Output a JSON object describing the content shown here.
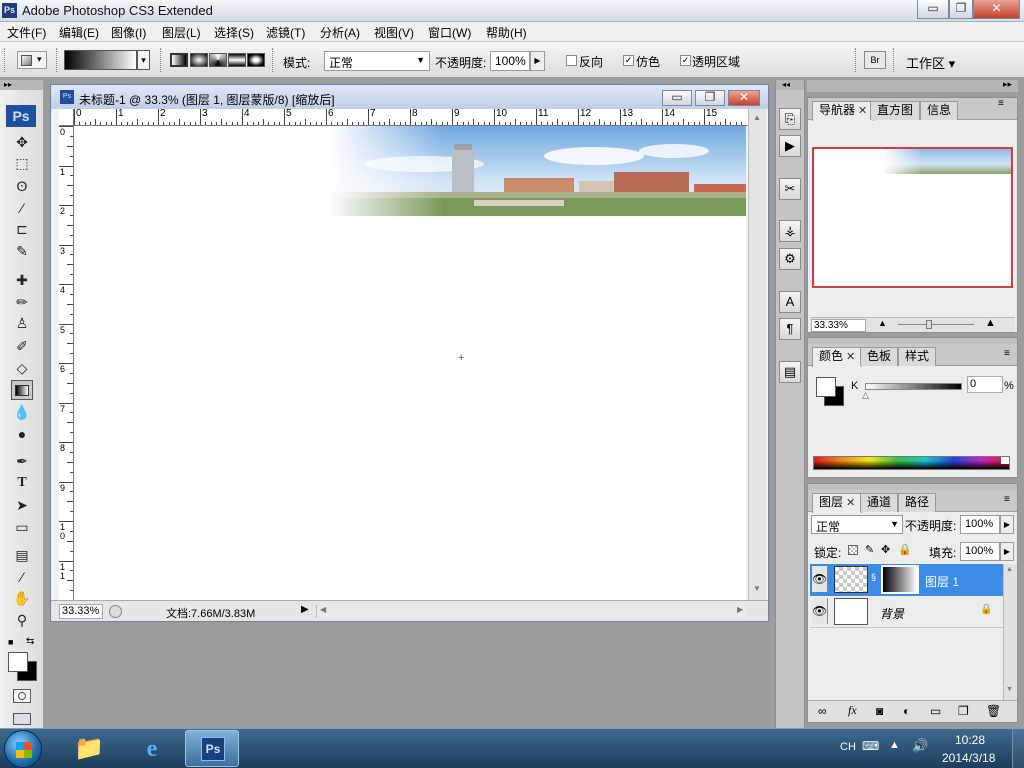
{
  "app": {
    "title": "Adobe Photoshop CS3 Extended",
    "logo": "Ps",
    "window_controls": {
      "minimize": "▭",
      "restore": "❐",
      "close": "✕"
    }
  },
  "menu": [
    "文件(F)",
    "编辑(E)",
    "图像(I)",
    "图层(L)",
    "选择(S)",
    "滤镜(T)",
    "分析(A)",
    "视图(V)",
    "窗口(W)",
    "帮助(H)"
  ],
  "options": {
    "mode_label": "模式:",
    "mode_value": "正常",
    "opacity_label": "不透明度:",
    "opacity_value": "100%",
    "reverse_label": "反向",
    "dither_label": "仿色",
    "transparency_label": "透明区域",
    "workspace_label": "工作区"
  },
  "document": {
    "title": "未标题-1 @ 33.3% (图层 1, 图层蒙版/8) [缩放后]",
    "ruler_top": [
      "0",
      "1",
      "2",
      "3",
      "4",
      "5",
      "6",
      "7",
      "8",
      "9",
      "10",
      "11",
      "12",
      "13",
      "14",
      "15"
    ],
    "ruler_left": [
      "0",
      "1",
      "2",
      "3",
      "4",
      "5",
      "6",
      "7",
      "8",
      "9",
      "1\n0",
      "1\n1"
    ],
    "zoom": "33.33%",
    "status": "文档:7.66M/3.83M"
  },
  "navigator": {
    "tabs": [
      "导航器",
      "直方图",
      "信息"
    ],
    "zoom": "33.33%"
  },
  "color": {
    "tabs": [
      "颜色",
      "色板",
      "样式"
    ],
    "channel": "K",
    "value": "0",
    "unit": "%"
  },
  "layers": {
    "tabs": [
      "图层",
      "通道",
      "路径"
    ],
    "blend_mode": "正常",
    "opacity_label": "不透明度:",
    "opacity_value": "100%",
    "lock_label": "锁定:",
    "fill_label": "填充:",
    "fill_value": "100%",
    "items": [
      {
        "name": "图层 1",
        "selected": true
      },
      {
        "name": "背景",
        "selected": false
      }
    ]
  },
  "taskbar": {
    "lang": "CH",
    "time": "10:28",
    "date": "2014/3/18"
  },
  "colors": {
    "selected_layer": "#3a8ce8",
    "taskbar": "#1d3d5c",
    "nav_frame": "#d33d3d"
  }
}
